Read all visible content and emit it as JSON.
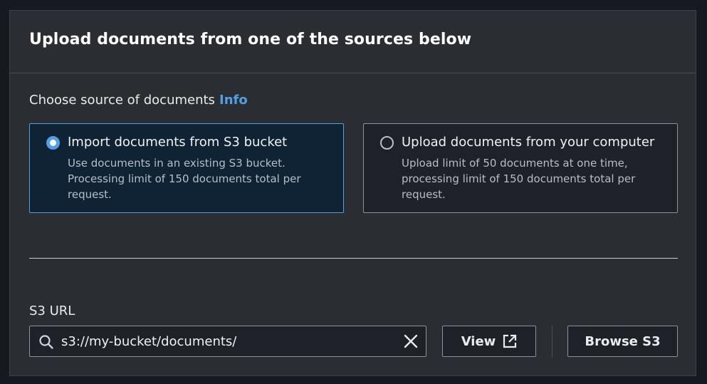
{
  "header": {
    "title": "Upload documents from one of the sources below"
  },
  "source_section": {
    "label": "Choose source of documents",
    "info_link": "Info",
    "options": [
      {
        "title": "Import documents from S3 bucket",
        "description": "Use documents in an existing S3 bucket. Processing limit of 150 documents total per request.",
        "selected": true
      },
      {
        "title": "Upload documents from your computer",
        "description": "Upload limit of 50 documents at one time, processing limit of 150 documents total per request.",
        "selected": false
      }
    ]
  },
  "s3_url": {
    "label": "S3 URL",
    "value": "s3://my-bucket/documents/",
    "search_icon": "search-icon",
    "clear_icon": "close-icon"
  },
  "actions": {
    "view_label": "View",
    "view_icon": "external-link-icon",
    "browse_label": "Browse S3"
  },
  "colors": {
    "accent": "#539fe5",
    "background": "#2a2e33",
    "selected_tile": "#0f2335"
  }
}
